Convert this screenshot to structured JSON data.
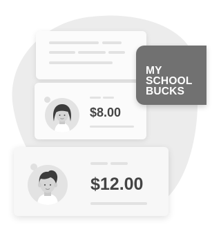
{
  "balances": [
    {
      "amount": "$8.00"
    },
    {
      "amount": "$12.00"
    }
  ],
  "logo": {
    "line1": "MY",
    "line2": "SCHOOL",
    "line3": "BUCKS"
  },
  "colors": {
    "logo_background": "#717171",
    "amount_text": "#444444"
  }
}
